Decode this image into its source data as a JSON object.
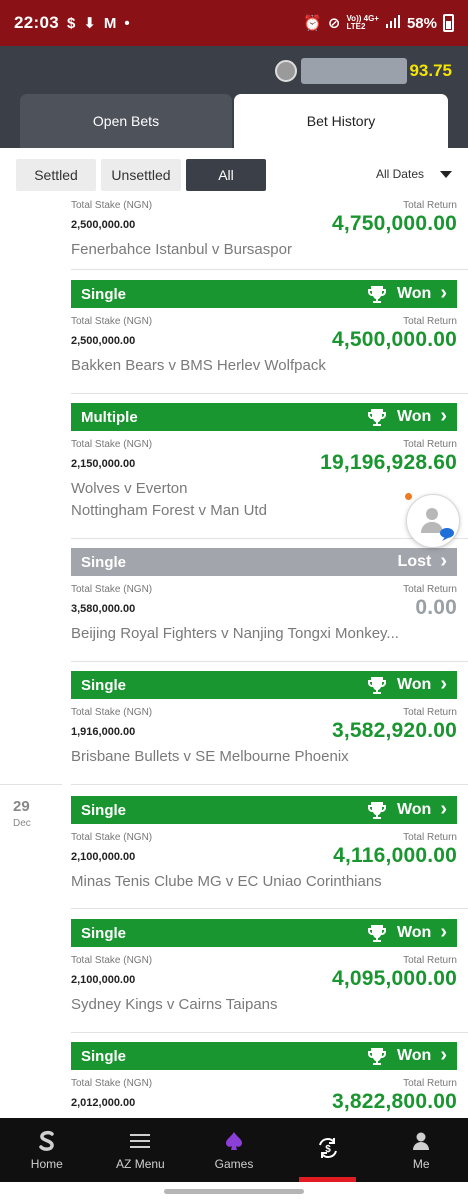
{
  "status_bar": {
    "time": "22:03",
    "network_top": "Vo)) 4G+",
    "network_bottom": "LTE2",
    "battery": "58%"
  },
  "header": {
    "balance": "93.75",
    "tabs": [
      {
        "label": "Open Bets",
        "active": false
      },
      {
        "label": "Bet History",
        "active": true
      }
    ]
  },
  "filters": {
    "buttons": [
      {
        "label": "Settled",
        "active": false
      },
      {
        "label": "Unsettled",
        "active": false
      },
      {
        "label": "All",
        "active": true
      }
    ],
    "dates_label": "All Dates"
  },
  "labels": {
    "stake": "Total Stake (NGN)",
    "return": "Total Return"
  },
  "bets": [
    {
      "type": "",
      "result": "",
      "stake": "2,500,000.00",
      "return": "4,750,000.00",
      "matches": [
        "Fenerbahce Istanbul v Bursaspor"
      ]
    },
    {
      "type": "Single",
      "result": "Won",
      "stake": "2,500,000.00",
      "return": "4,500,000.00",
      "matches": [
        "Bakken Bears v BMS Herlev Wolfpack"
      ]
    },
    {
      "type": "Multiple",
      "result": "Won",
      "stake": "2,150,000.00",
      "return": "19,196,928.60",
      "matches": [
        "Wolves v Everton",
        "Nottingham Forest v Man Utd"
      ]
    },
    {
      "type": "Single",
      "result": "Lost",
      "stake": "3,580,000.00",
      "return": "0.00",
      "matches": [
        "Beijing Royal Fighters v Nanjing Tongxi Monkey..."
      ]
    },
    {
      "type": "Single",
      "result": "Won",
      "stake": "1,916,000.00",
      "return": "3,582,920.00",
      "matches": [
        "Brisbane Bullets v SE Melbourne Phoenix"
      ]
    },
    {
      "type": "Single",
      "result": "Won",
      "stake": "2,100,000.00",
      "return": "4,116,000.00",
      "matches": [
        "Minas Tenis Clube MG v EC Uniao Corinthians"
      ]
    },
    {
      "type": "Single",
      "result": "Won",
      "stake": "2,100,000.00",
      "return": "4,095,000.00",
      "matches": [
        "Sydney Kings v Cairns Taipans"
      ]
    },
    {
      "type": "Single",
      "result": "Won",
      "stake": "2,012,000.00",
      "return": "3,822,800.00",
      "matches": []
    }
  ],
  "date_group": {
    "day": "29",
    "month": "Dec"
  },
  "bottom_nav": [
    {
      "label": "Home",
      "icon": "sportsbook-logo-icon",
      "active": false
    },
    {
      "label": "AZ Menu",
      "icon": "hamburger-menu-icon",
      "active": false
    },
    {
      "label": "Games",
      "icon": "spade-icon",
      "active": false
    },
    {
      "label": "",
      "icon": "cash-out-icon",
      "active": true
    },
    {
      "label": "Me",
      "icon": "user-icon",
      "active": false
    }
  ],
  "colors": {
    "status_bar": "#8a1116",
    "header": "#3b3f47",
    "won": "#19962f",
    "lost": "#a2a5ab",
    "balance": "#f5e400",
    "nav_active": "#e31b23"
  }
}
